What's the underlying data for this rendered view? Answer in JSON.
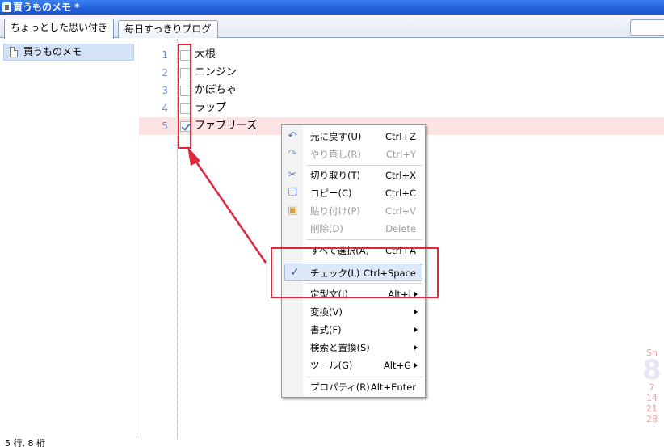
{
  "window": {
    "title": "買うものメモ *"
  },
  "tabs": [
    {
      "label": "ちょっとした思い付き",
      "active": true
    },
    {
      "label": "毎日すっきりブログ",
      "active": false
    }
  ],
  "sidebar": {
    "items": [
      {
        "label": "買うものメモ",
        "icon": "document-icon"
      }
    ]
  },
  "editor": {
    "lines": [
      {
        "num": "1",
        "text": "大根",
        "checked": false
      },
      {
        "num": "2",
        "text": "ニンジン",
        "checked": false
      },
      {
        "num": "3",
        "text": "かぼちゃ",
        "checked": false
      },
      {
        "num": "4",
        "text": "ラップ",
        "checked": false
      },
      {
        "num": "5",
        "text": "ファブリーズ",
        "checked": true
      }
    ]
  },
  "context_menu": {
    "items": [
      {
        "label": "元に戻す(U)",
        "shortcut": "Ctrl+Z",
        "icon": "undo-icon"
      },
      {
        "label": "やり直し(R)",
        "shortcut": "Ctrl+Y",
        "icon": "redo-icon",
        "disabled": true
      },
      {
        "label": "切り取り(T)",
        "shortcut": "Ctrl+X",
        "icon": "cut-icon"
      },
      {
        "label": "コピー(C)",
        "shortcut": "Ctrl+C",
        "icon": "copy-icon"
      },
      {
        "label": "貼り付け(P)",
        "shortcut": "Ctrl+V",
        "icon": "paste-icon",
        "disabled": true
      },
      {
        "label": "削除(D)",
        "shortcut": "Delete",
        "disabled": true
      },
      {
        "label": "すべて選択(A)",
        "shortcut": "Ctrl+A"
      },
      {
        "label": "チェック(L)",
        "shortcut": "Ctrl+Space",
        "icon": "check-icon",
        "highlighted": true
      },
      {
        "label": "定型文(I)",
        "shortcut": "Alt+I",
        "submenu": true
      },
      {
        "label": "変換(V)",
        "submenu": true
      },
      {
        "label": "書式(F)",
        "submenu": true
      },
      {
        "label": "検索と置換(S)",
        "submenu": true
      },
      {
        "label": "ツール(G)",
        "shortcut": "Alt+G",
        "submenu": true
      },
      {
        "label": "プロパティ(R)",
        "shortcut": "Alt+Enter"
      }
    ]
  },
  "calendar": {
    "day_header": "Sn",
    "days": [
      "7",
      "14",
      "21",
      "28"
    ]
  },
  "status": {
    "text": "5 行, 8 桁"
  },
  "colors": {
    "annotation_red": "#e0263a",
    "line_number": "#6f8fd0",
    "current_line": "#fde3e3"
  }
}
